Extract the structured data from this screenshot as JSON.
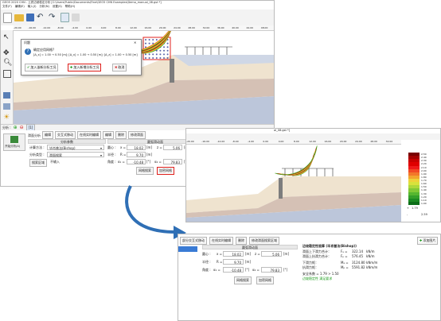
{
  "window": {
    "title": "GEO5 2020 CHN - 土质边坡稳定分析 [C:\\Users\\Public\\Documents\\Fine\\GEO5 CHN Examples\\Demo_manual_08.gst *]",
    "menu": [
      "文件(F)",
      "编辑(E)",
      "输入(I)",
      "分析(N)",
      "设置(S)",
      "帮助(H)"
    ]
  },
  "ruler_ticks": [
    "-20.00",
    "-16.00",
    "-12.00",
    "-8.00",
    "-4.00",
    "0.00",
    "4.00",
    "8.00",
    "12.00",
    "16.00",
    "20.00",
    "24.00",
    "28.00",
    "32.00",
    "36.00",
    "40.00",
    "44.00",
    "48.00"
  ],
  "dialog": {
    "title": "问题",
    "question": "确定应用网格?",
    "detail": "[Δ_x] = 1.00 → 0.50 [m]; [Δ_x] = 1.00 → 0.50 [m]; [Δ_z] = 1.00 → 0.50 [m]",
    "btn_add_analysis": "加入该新分析工况",
    "btn_add_new": "加入新增分析工况",
    "btn_cancel": "取消"
  },
  "panel1": {
    "toolbar": {
      "analysis": "分析 :",
      "tab1": "[1]",
      "stage_label": "阶段 :"
    },
    "left_label": "开始分析(A)",
    "tabs": {
      "method": "滑面分析",
      "edit": "编辑",
      "interactive": "交互式移动",
      "add_surface": "在线实时编辑",
      "draw": "编辑",
      "delete": "删除",
      "search_plane": "修改滑面"
    },
    "params_hdr": "分析参数",
    "method_label": "计算方法 :",
    "method_value": "毕肖普法(Bishop)",
    "type_label": "分析类型 :",
    "type_value": "滑面搜索",
    "restriction_btn": "搜索区域",
    "restriction_value": "不输入",
    "circle_hdr": "圆弧滑动面",
    "center_label": "圆心 :",
    "x_label": "x =",
    "x_value": "18.02",
    "z_label": "z =",
    "z_value": "5.06",
    "unit_m": "[m]",
    "radius_label": "半径 :",
    "r_label": "R =",
    "r_value": "9.70",
    "angle_label": "角度 :",
    "a1_label": "α₁ =",
    "a1_value": "-10.48",
    "a2_label": "α₂ =",
    "a2_value": "79.83",
    "unit_deg": "[°]",
    "btn_grid": "网格搜索",
    "btn_refine": "加密网格"
  },
  "results": {
    "title": "边坡稳定性验算 (毕肖普法(Bishop))",
    "line1_label": "滑面上下滑力合计：",
    "line1_sym": "Fₐ =",
    "line1_val": "322.14",
    "line1_unit": "kN/m",
    "line2_label": "滑面上抗滑力合计：",
    "line2_sym": "Fₚ =",
    "line2_val": "576.45",
    "line2_unit": "kN/m",
    "line3_label": "下滑力矩：",
    "line3_sym": "Mₐ =",
    "line3_val": "3124.80",
    "line3_unit": "kNm/m",
    "line4_label": "抗滑力矩：",
    "line4_sym": "Mₚ =",
    "line4_val": "5591.82",
    "line4_unit": "kNm/m",
    "safety": "安全系数 = 1.79 > 1.50",
    "ok": "边坡稳定性 满足要求"
  },
  "panel2": {
    "title_fragment": "al_08.gst *]",
    "legend_values": [
      "2.50",
      "2.40",
      "2.30",
      "2.20",
      "2.10",
      "2.00",
      "1.90",
      "1.80",
      "1.70",
      "1.60",
      "1.50",
      "1.40",
      "1.30",
      "1.20",
      "1.10",
      "1.00"
    ],
    "legend_min": "1.79",
    "legend_max": "2.59",
    "legend_plus": "+",
    "legend_minus": "-"
  },
  "panel3": {
    "tabs": {
      "interactive": "部分交互式移动",
      "add_surface": "在线实时编辑",
      "delete": "删除",
      "search_plane": "修改滑面搜索区域"
    },
    "report_btn": "添加图片",
    "circle_hdr": "圆弧滑动面",
    "center_label": "圆心 :",
    "x_label": "x =",
    "x_value": "18.02",
    "z_label": "z =",
    "z_value": "5.06",
    "unit_m": "[m]",
    "radius_label": "半径 :",
    "r_label": "R =",
    "r_value": "9.70",
    "angle_label": "角度 :",
    "a1_label": "α₁ =",
    "a1_value": "-10.48",
    "a2_label": "α₂ =",
    "a2_value": "79.83",
    "unit_deg": "[°]",
    "btn_grid": "网格搜索",
    "btn_refine": "加密网格"
  },
  "colors": {
    "accent_red": "#e0201c",
    "ok_green": "#1c9c1c",
    "arrow_blue": "#2f6fb5"
  }
}
